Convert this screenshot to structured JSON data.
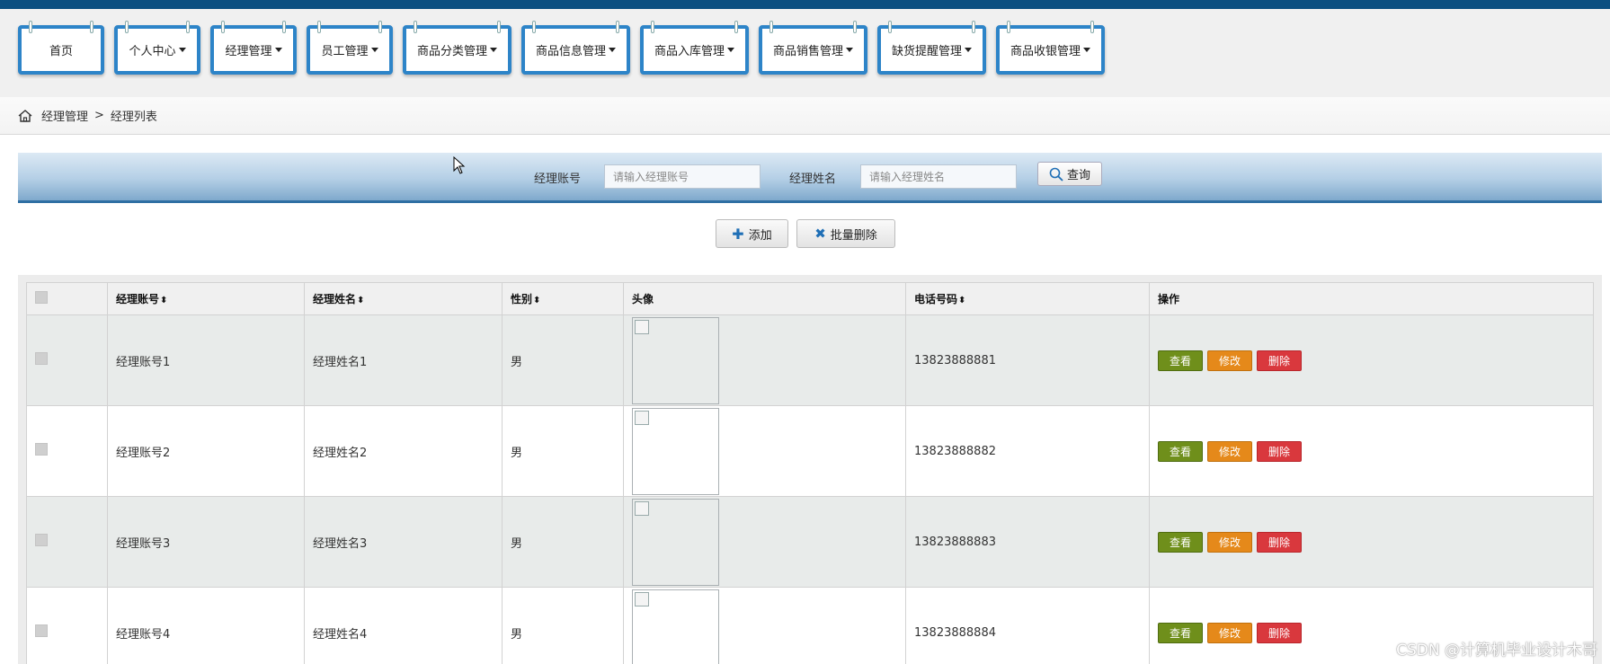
{
  "nav": {
    "items": [
      {
        "label": "首页",
        "dropdown": false
      },
      {
        "label": "个人中心",
        "dropdown": true
      },
      {
        "label": "经理管理",
        "dropdown": true
      },
      {
        "label": "员工管理",
        "dropdown": true
      },
      {
        "label": "商品分类管理",
        "dropdown": true
      },
      {
        "label": "商品信息管理",
        "dropdown": true
      },
      {
        "label": "商品入库管理",
        "dropdown": true
      },
      {
        "label": "商品销售管理",
        "dropdown": true
      },
      {
        "label": "缺货提醒管理",
        "dropdown": true
      },
      {
        "label": "商品收银管理",
        "dropdown": true
      }
    ]
  },
  "breadcrumb": {
    "parent": "经理管理",
    "separator": ">",
    "current": "经理列表"
  },
  "search": {
    "account_label": "经理账号",
    "account_placeholder": "请输入经理账号",
    "name_label": "经理姓名",
    "name_placeholder": "请输入经理姓名",
    "query_label": "查询"
  },
  "actions": {
    "add_label": "添加",
    "batch_delete_label": "批量删除"
  },
  "table": {
    "headers": {
      "account": "经理账号",
      "name": "经理姓名",
      "gender": "性别",
      "avatar": "头像",
      "phone": "电话号码",
      "ops": "操作"
    },
    "rows": [
      {
        "account": "经理账号1",
        "name": "经理姓名1",
        "gender": "男",
        "phone": "13823888881"
      },
      {
        "account": "经理账号2",
        "name": "经理姓名2",
        "gender": "男",
        "phone": "13823888882"
      },
      {
        "account": "经理账号3",
        "name": "经理姓名3",
        "gender": "男",
        "phone": "13823888883"
      },
      {
        "account": "经理账号4",
        "name": "经理姓名4",
        "gender": "男",
        "phone": "13823888884"
      }
    ],
    "op_labels": {
      "view": "查看",
      "edit": "修改",
      "delete": "删除"
    }
  },
  "watermark": "CSDN @计算机毕业设计木哥",
  "colors": {
    "topbar": "#0b4f80",
    "nav_border": "#2d84c8",
    "view_button": "#6f8f1b",
    "edit_button": "#e5891a",
    "delete_button": "#d9383d"
  }
}
